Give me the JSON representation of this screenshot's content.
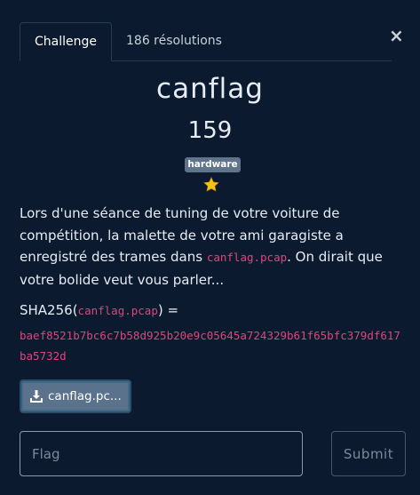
{
  "tabs": {
    "challenge": "Challenge",
    "solves": "186 résolutions"
  },
  "close_label": "×",
  "challenge": {
    "name": "canflag",
    "points": "159",
    "tag": "hardware",
    "difficulty_icon": "star-icon",
    "description": {
      "part1": "Lors d'une séance de tuning de votre voiture de compétition, la malette de votre ami garagiste a enregistré des trames dans ",
      "file_code": "canflag.pcap",
      "part2": ". On dirait que votre bolide veut vous parler..."
    },
    "hash": {
      "prefix": "SHA256(",
      "file": "canflag.pcap",
      "suffix": ") =",
      "value": "baef8521b7bc6c7b58d925b20e9c05645a724329b61f65bfc379df617ba5732d"
    },
    "download_label": "canflag.pc...",
    "download_icon": "download-icon"
  },
  "form": {
    "flag_placeholder": "Flag",
    "submit_label": "Submit"
  },
  "colors": {
    "background": "#0c1a30",
    "code": "#e0447a",
    "tag_bg": "#5f738a",
    "star": "#f3c316"
  }
}
